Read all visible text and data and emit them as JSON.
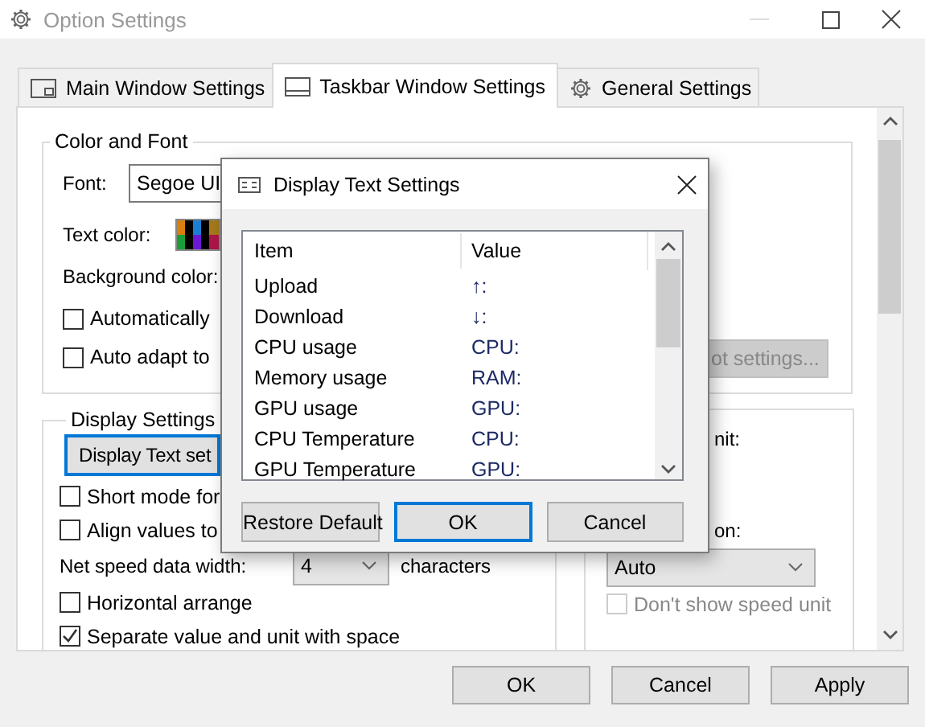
{
  "window": {
    "title": "Option Settings"
  },
  "tabs": [
    {
      "label": "Main Window Settings",
      "selected": false
    },
    {
      "label": "Taskbar Window Settings",
      "selected": true
    },
    {
      "label": "General Settings",
      "selected": false
    }
  ],
  "color_and_font": {
    "title": "Color and Font",
    "font_label": "Font:",
    "font_value": "Segoe UI",
    "text_color_label": "Text color:",
    "background_color_label": "Background color:",
    "checkboxes": [
      {
        "label": "Automatically",
        "checked": false
      },
      {
        "label": "Auto adapt to",
        "checked": false
      }
    ],
    "button": "ot settings..."
  },
  "display_settings": {
    "title": "Display Settings",
    "button": "Display Text set",
    "checkboxes": [
      {
        "label": "Short mode for",
        "checked": false
      },
      {
        "label": "Align values to",
        "checked": false
      }
    ],
    "net_speed_label": "Net speed data width:",
    "net_speed_value": "4",
    "net_speed_unit": "characters",
    "checkboxes_2": [
      {
        "label": "Horizontal arrange",
        "checked": false
      },
      {
        "label": "Separate value and unit with space",
        "checked": true
      }
    ]
  },
  "right_group": {
    "label_1": "nit:",
    "label_2": "on:",
    "combo": "Auto",
    "checkbox": {
      "label": "Don't show speed unit",
      "checked": false,
      "disabled": true
    }
  },
  "buttons": [
    "OK",
    "Cancel",
    "Apply"
  ],
  "dialog": {
    "title": "Display Text Settings",
    "columns": [
      "Item",
      "Value"
    ],
    "rows": [
      {
        "item": "Upload",
        "value": "↑:"
      },
      {
        "item": "Download",
        "value": "↓:"
      },
      {
        "item": "CPU usage",
        "value": "CPU:"
      },
      {
        "item": "Memory usage",
        "value": "RAM:"
      },
      {
        "item": "GPU usage",
        "value": "GPU:"
      },
      {
        "item": "CPU Temperature",
        "value": "CPU:"
      },
      {
        "item": "GPU Temperature",
        "value": "GPU:"
      }
    ],
    "buttons": [
      {
        "label": "Restore Default",
        "default": false
      },
      {
        "label": "OK",
        "default": true
      },
      {
        "label": "Cancel",
        "default": false
      }
    ]
  }
}
